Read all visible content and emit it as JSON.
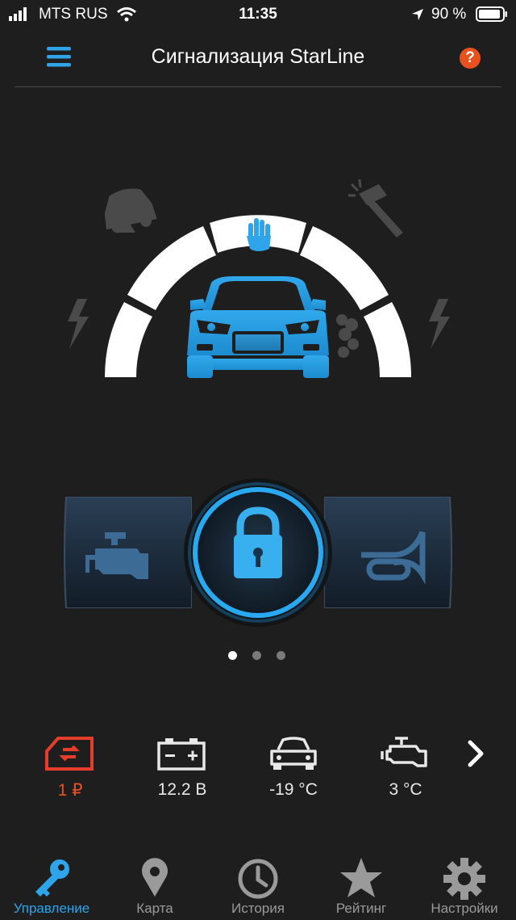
{
  "status_bar": {
    "carrier": "MTS RUS",
    "time": "11:35",
    "battery": "90 %"
  },
  "header": {
    "title": "Сигнализация StarLine",
    "help": "?"
  },
  "controls": {
    "left": "engine-start",
    "center": "lock",
    "right": "horn"
  },
  "pagination": {
    "pages": 3,
    "active": 0
  },
  "status": {
    "balance": "1 ₽",
    "voltage": "12.2 В",
    "interior_temp": "-19 °C",
    "engine_temp": "3 °C"
  },
  "tabs": [
    {
      "label": "Управление",
      "icon": "key-icon",
      "active": true
    },
    {
      "label": "Карта",
      "icon": "map-pin-icon",
      "active": false
    },
    {
      "label": "История",
      "icon": "clock-icon",
      "active": false
    },
    {
      "label": "Рейтинг",
      "icon": "star-icon",
      "active": false
    },
    {
      "label": "Настройки",
      "icon": "gear-icon",
      "active": false
    }
  ],
  "colors": {
    "accent": "#2fa4e8",
    "alert": "#e53c2b",
    "help": "#e8501e"
  }
}
